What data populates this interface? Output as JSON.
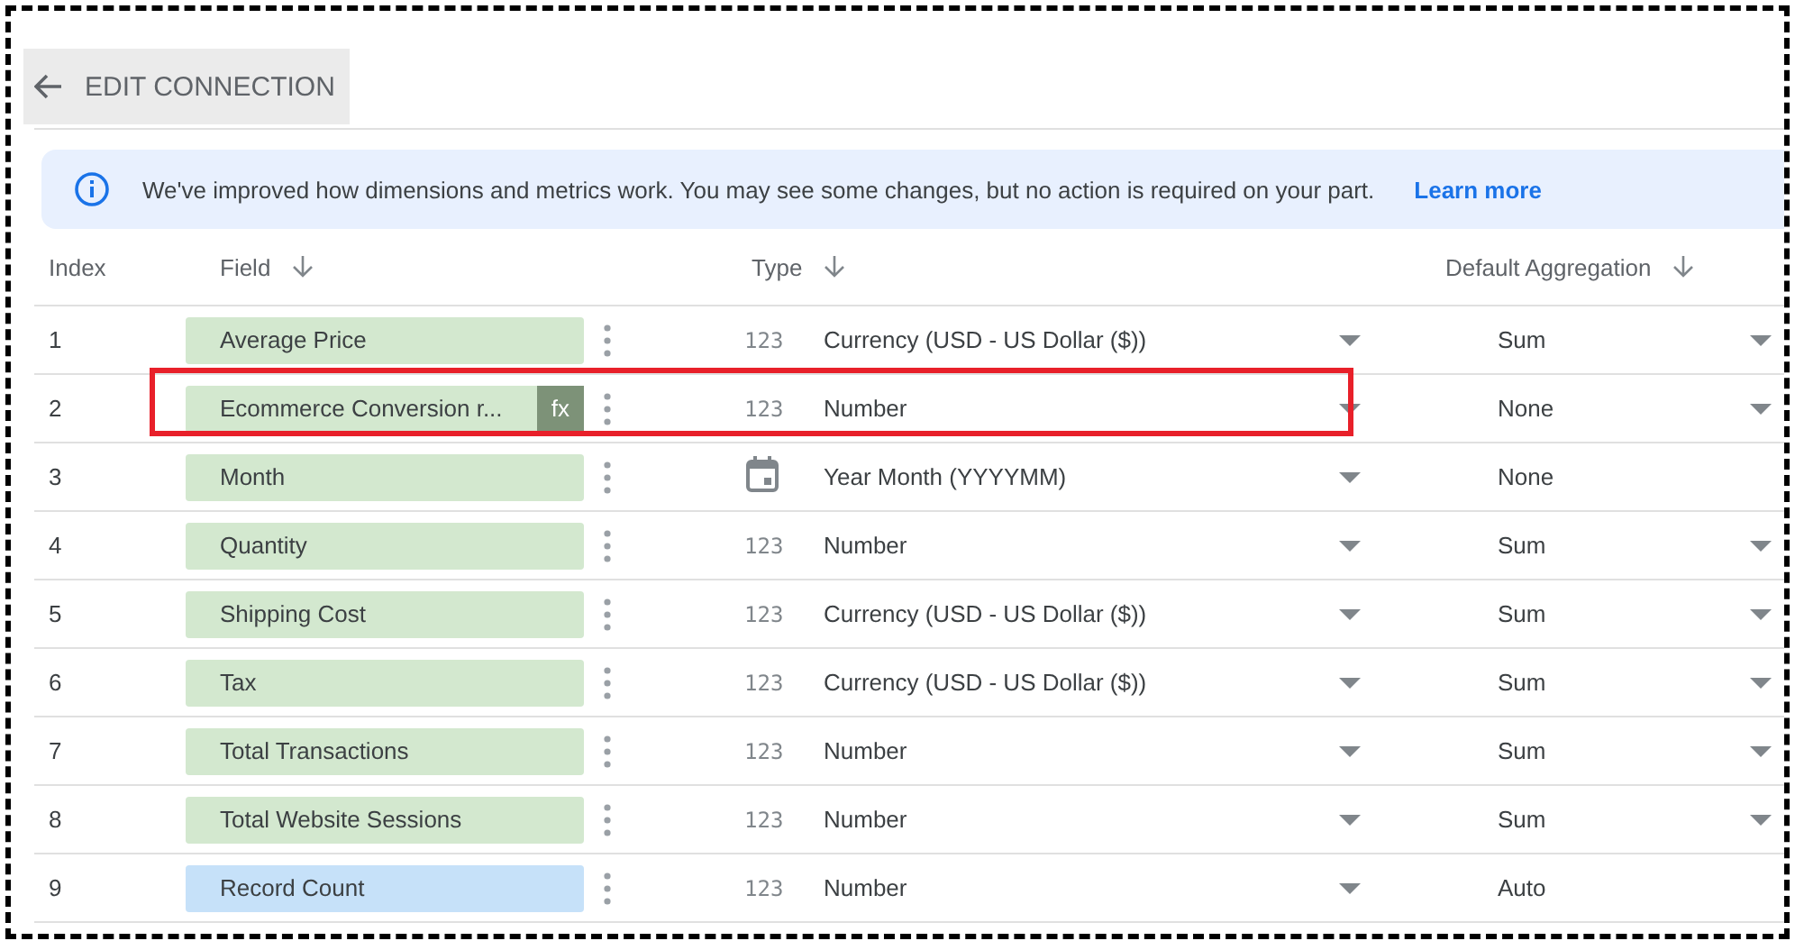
{
  "header": {
    "back_label": "EDIT CONNECTION"
  },
  "banner": {
    "message": "We've improved how dimensions and metrics work. You may see some changes, but no action is required on your part.",
    "link": "Learn more"
  },
  "table": {
    "columns": [
      "Index",
      "Field",
      "Type",
      "Default Aggregation"
    ],
    "rows": [
      {
        "index": "1",
        "field": "Average Price",
        "color": "#d3e8cf",
        "formula": false,
        "type": {
          "kind": "number",
          "symbol": "123",
          "label": "Currency (USD - US Dollar ($))"
        },
        "aggregation": "Sum",
        "aggregation_editable": true,
        "highlighted": false
      },
      {
        "index": "2",
        "field": "Ecommerce Conversion r...",
        "color": "#d3e8cf",
        "formula": true,
        "formula_label": "fx",
        "type": {
          "kind": "number",
          "symbol": "123",
          "label": "Number"
        },
        "aggregation": "None",
        "aggregation_editable": true,
        "highlighted": true
      },
      {
        "index": "3",
        "field": "Month",
        "color": "#d3e8cf",
        "formula": false,
        "type": {
          "kind": "date",
          "label": "Year Month (YYYYMM)"
        },
        "aggregation": "None",
        "aggregation_editable": false,
        "highlighted": false
      },
      {
        "index": "4",
        "field": "Quantity",
        "color": "#d3e8cf",
        "formula": false,
        "type": {
          "kind": "number",
          "symbol": "123",
          "label": "Number"
        },
        "aggregation": "Sum",
        "aggregation_editable": true,
        "highlighted": false
      },
      {
        "index": "5",
        "field": "Shipping Cost",
        "color": "#d3e8cf",
        "formula": false,
        "type": {
          "kind": "number",
          "symbol": "123",
          "label": "Currency (USD - US Dollar ($))"
        },
        "aggregation": "Sum",
        "aggregation_editable": true,
        "highlighted": false
      },
      {
        "index": "6",
        "field": "Tax",
        "color": "#d3e8cf",
        "formula": false,
        "type": {
          "kind": "number",
          "symbol": "123",
          "label": "Currency (USD - US Dollar ($))"
        },
        "aggregation": "Sum",
        "aggregation_editable": true,
        "highlighted": false
      },
      {
        "index": "7",
        "field": "Total Transactions",
        "color": "#d3e8cf",
        "formula": false,
        "type": {
          "kind": "number",
          "symbol": "123",
          "label": "Number"
        },
        "aggregation": "Sum",
        "aggregation_editable": true,
        "highlighted": false
      },
      {
        "index": "8",
        "field": "Total Website Sessions",
        "color": "#d3e8cf",
        "formula": false,
        "type": {
          "kind": "number",
          "symbol": "123",
          "label": "Number"
        },
        "aggregation": "Sum",
        "aggregation_editable": true,
        "highlighted": false
      },
      {
        "index": "9",
        "field": "Record Count",
        "color": "#c6e1f9",
        "formula": false,
        "type": {
          "kind": "number",
          "symbol": "123",
          "label": "Number"
        },
        "aggregation": "Auto",
        "aggregation_editable": false,
        "highlighted": false
      }
    ]
  }
}
